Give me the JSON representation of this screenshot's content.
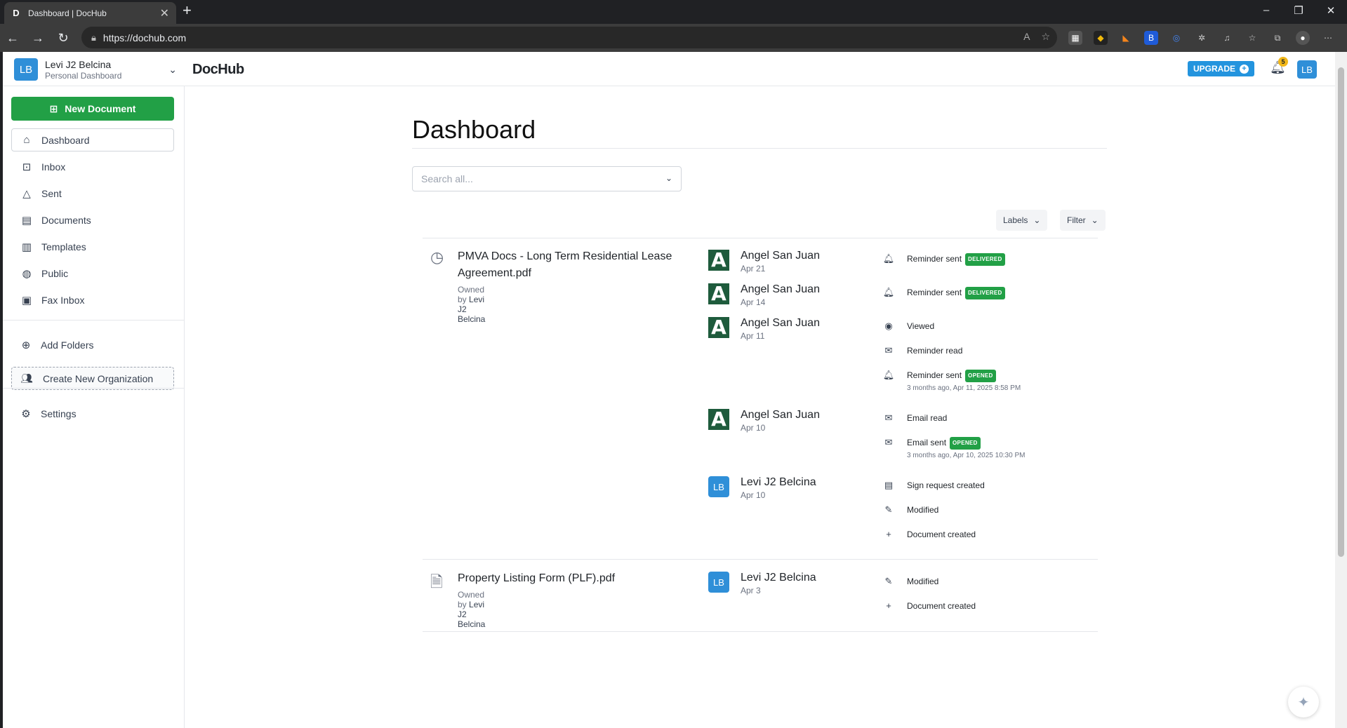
{
  "browser": {
    "tab_title": "Dashboard | DocHub",
    "url": "https://dochub.com"
  },
  "header": {
    "user_name": "Levi J2 Belcina",
    "user_sub": "Personal Dashboard",
    "user_initials": "LB",
    "logo": "DocHub",
    "upgrade_label": "UPGRADE",
    "notification_count": "5"
  },
  "sidebar": {
    "new_document": "New Document",
    "items": [
      {
        "label": "Dashboard",
        "icon": "home-icon"
      },
      {
        "label": "Inbox",
        "icon": "inbox-icon"
      },
      {
        "label": "Sent",
        "icon": "send-icon"
      },
      {
        "label": "Documents",
        "icon": "document-icon"
      },
      {
        "label": "Templates",
        "icon": "template-icon"
      },
      {
        "label": "Public",
        "icon": "globe-icon"
      },
      {
        "label": "Fax Inbox",
        "icon": "fax-icon"
      }
    ],
    "add_folders": "Add Folders",
    "create_org": "Create New Organization",
    "settings": "Settings"
  },
  "main": {
    "title": "Dashboard",
    "search_placeholder": "Search all...",
    "labels_btn": "Labels",
    "filter_btn": "Filter"
  },
  "documents": [
    {
      "name": "PMVA Docs - Long Term Residential Lease Agreement.pdf",
      "owned_by_prefix": "Owned by",
      "owner": "Levi J2 Belcina",
      "people": [
        {
          "name": "Angel San Juan",
          "date": "Apr 21"
        },
        {
          "name": "Angel San Juan",
          "date": "Apr 14"
        },
        {
          "name": "Angel San Juan",
          "date": "Apr 11"
        },
        {
          "name": "Angel San Juan",
          "date": "Apr 10"
        },
        {
          "name": "Levi J2 Belcina",
          "date": "Apr 10"
        }
      ],
      "events": [
        {
          "text": "Reminder sent",
          "badge": "DELIVERED",
          "icon": "bell-icon"
        },
        {
          "text": "Reminder sent",
          "badge": "DELIVERED",
          "icon": "bell-icon"
        },
        {
          "text": "Viewed",
          "icon": "eye-icon"
        },
        {
          "text": "Reminder read",
          "icon": "envelope-open-icon"
        },
        {
          "text": "Reminder sent",
          "badge": "OPENED",
          "sub": "3 months ago, Apr 11, 2025 8:58 PM",
          "icon": "bell-icon"
        },
        {
          "text": "Email read",
          "icon": "envelope-open-icon"
        },
        {
          "text": "Email sent",
          "badge": "OPENED",
          "sub": "3 months ago, Apr 10, 2025 10:30 PM",
          "icon": "envelope-icon"
        },
        {
          "text": "Sign request created",
          "icon": "sign-request-icon"
        },
        {
          "text": "Modified",
          "icon": "edit-icon"
        },
        {
          "text": "Document created",
          "icon": "plus-icon"
        }
      ]
    },
    {
      "name": "Property Listing Form (PLF).pdf",
      "owned_by_prefix": "Owned by",
      "owner": "Levi J2 Belcina",
      "people": [
        {
          "name": "Levi J2 Belcina",
          "date": "Apr 3"
        }
      ],
      "events": [
        {
          "text": "Modified",
          "icon": "edit-icon"
        },
        {
          "text": "Document created",
          "icon": "plus-icon"
        }
      ]
    }
  ],
  "colors": {
    "primary_green": "#22a046",
    "brand_blue": "#2394de",
    "avatar_blue": "#2f8fd8",
    "angel_avatar": "#1e5b3c"
  }
}
